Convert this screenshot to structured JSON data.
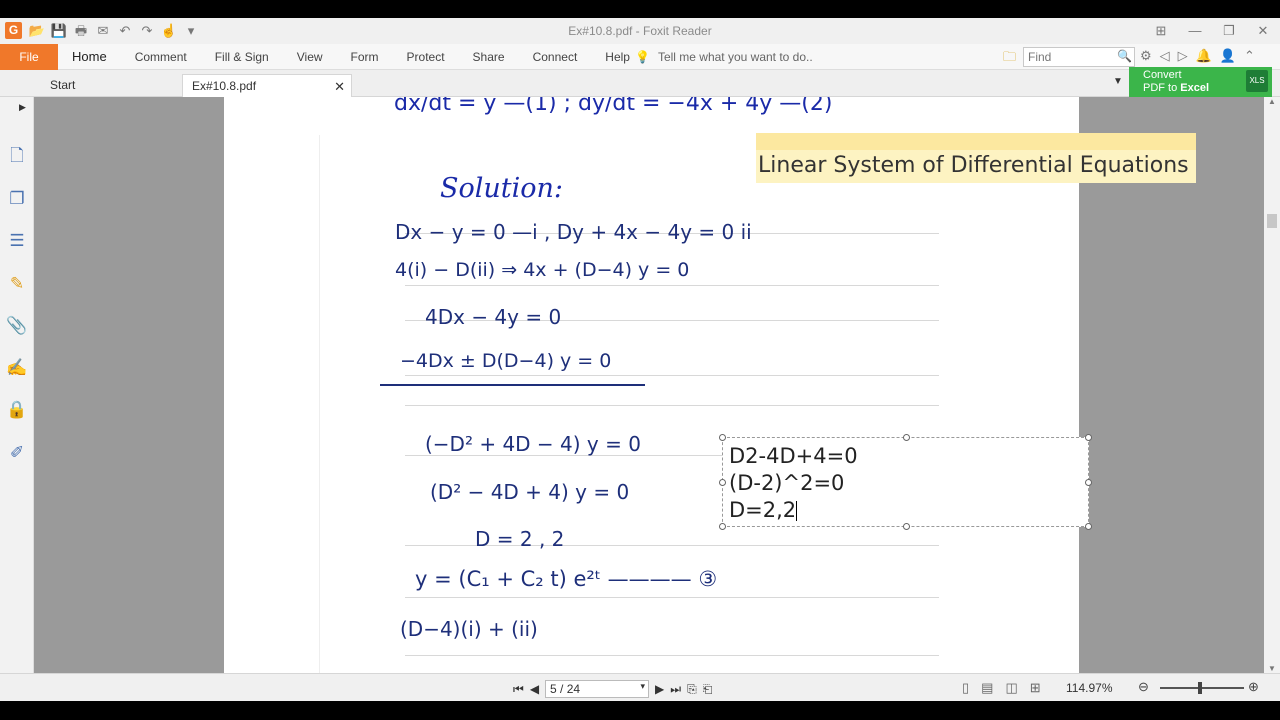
{
  "window": {
    "title": "Ex#10.8.pdf - Foxit Reader"
  },
  "app_logo": "G",
  "ribbon": {
    "file": "File",
    "menus": [
      "Home",
      "Comment",
      "Fill & Sign",
      "View",
      "Form",
      "Protect",
      "Share",
      "Connect",
      "Help"
    ],
    "tell_me": "Tell me what you want to do..",
    "find_placeholder": "Find"
  },
  "tabs": {
    "start": "Start",
    "doc": "Ex#10.8.pdf"
  },
  "convert": {
    "line1": "Convert",
    "line2_prefix": "PDF to ",
    "line2_bold": "Excel",
    "badge": "XLS"
  },
  "document": {
    "banner": "Linear System of Differential Equations",
    "handwriting_top": "dx/dt = y —(1) ; dy/dt = −4x + 4y —(2)",
    "solution": "Solution:",
    "lines": [
      "Dx − y = 0 —i ,   Dy + 4x − 4y = 0  ii",
      "4(i)   − D(ii)              ⇒ 4x + (D−4) y = 0",
      "4Dx − 4y = 0",
      "−4Dx ± D(D−4) y = 0",
      "(−D² + 4D − 4) y = 0",
      "(D² − 4D + 4) y = 0",
      "D = 2 , 2",
      "y = (C₁ + C₂ t) e²ᵗ ———— ③",
      "(D−4)(i)  + (ii)"
    ],
    "textbox": [
      "D2-4D+4=0",
      "(D-2)^2=0",
      "D=2,2"
    ]
  },
  "status": {
    "page_display": "5 / 24",
    "zoom": "114.97%"
  }
}
